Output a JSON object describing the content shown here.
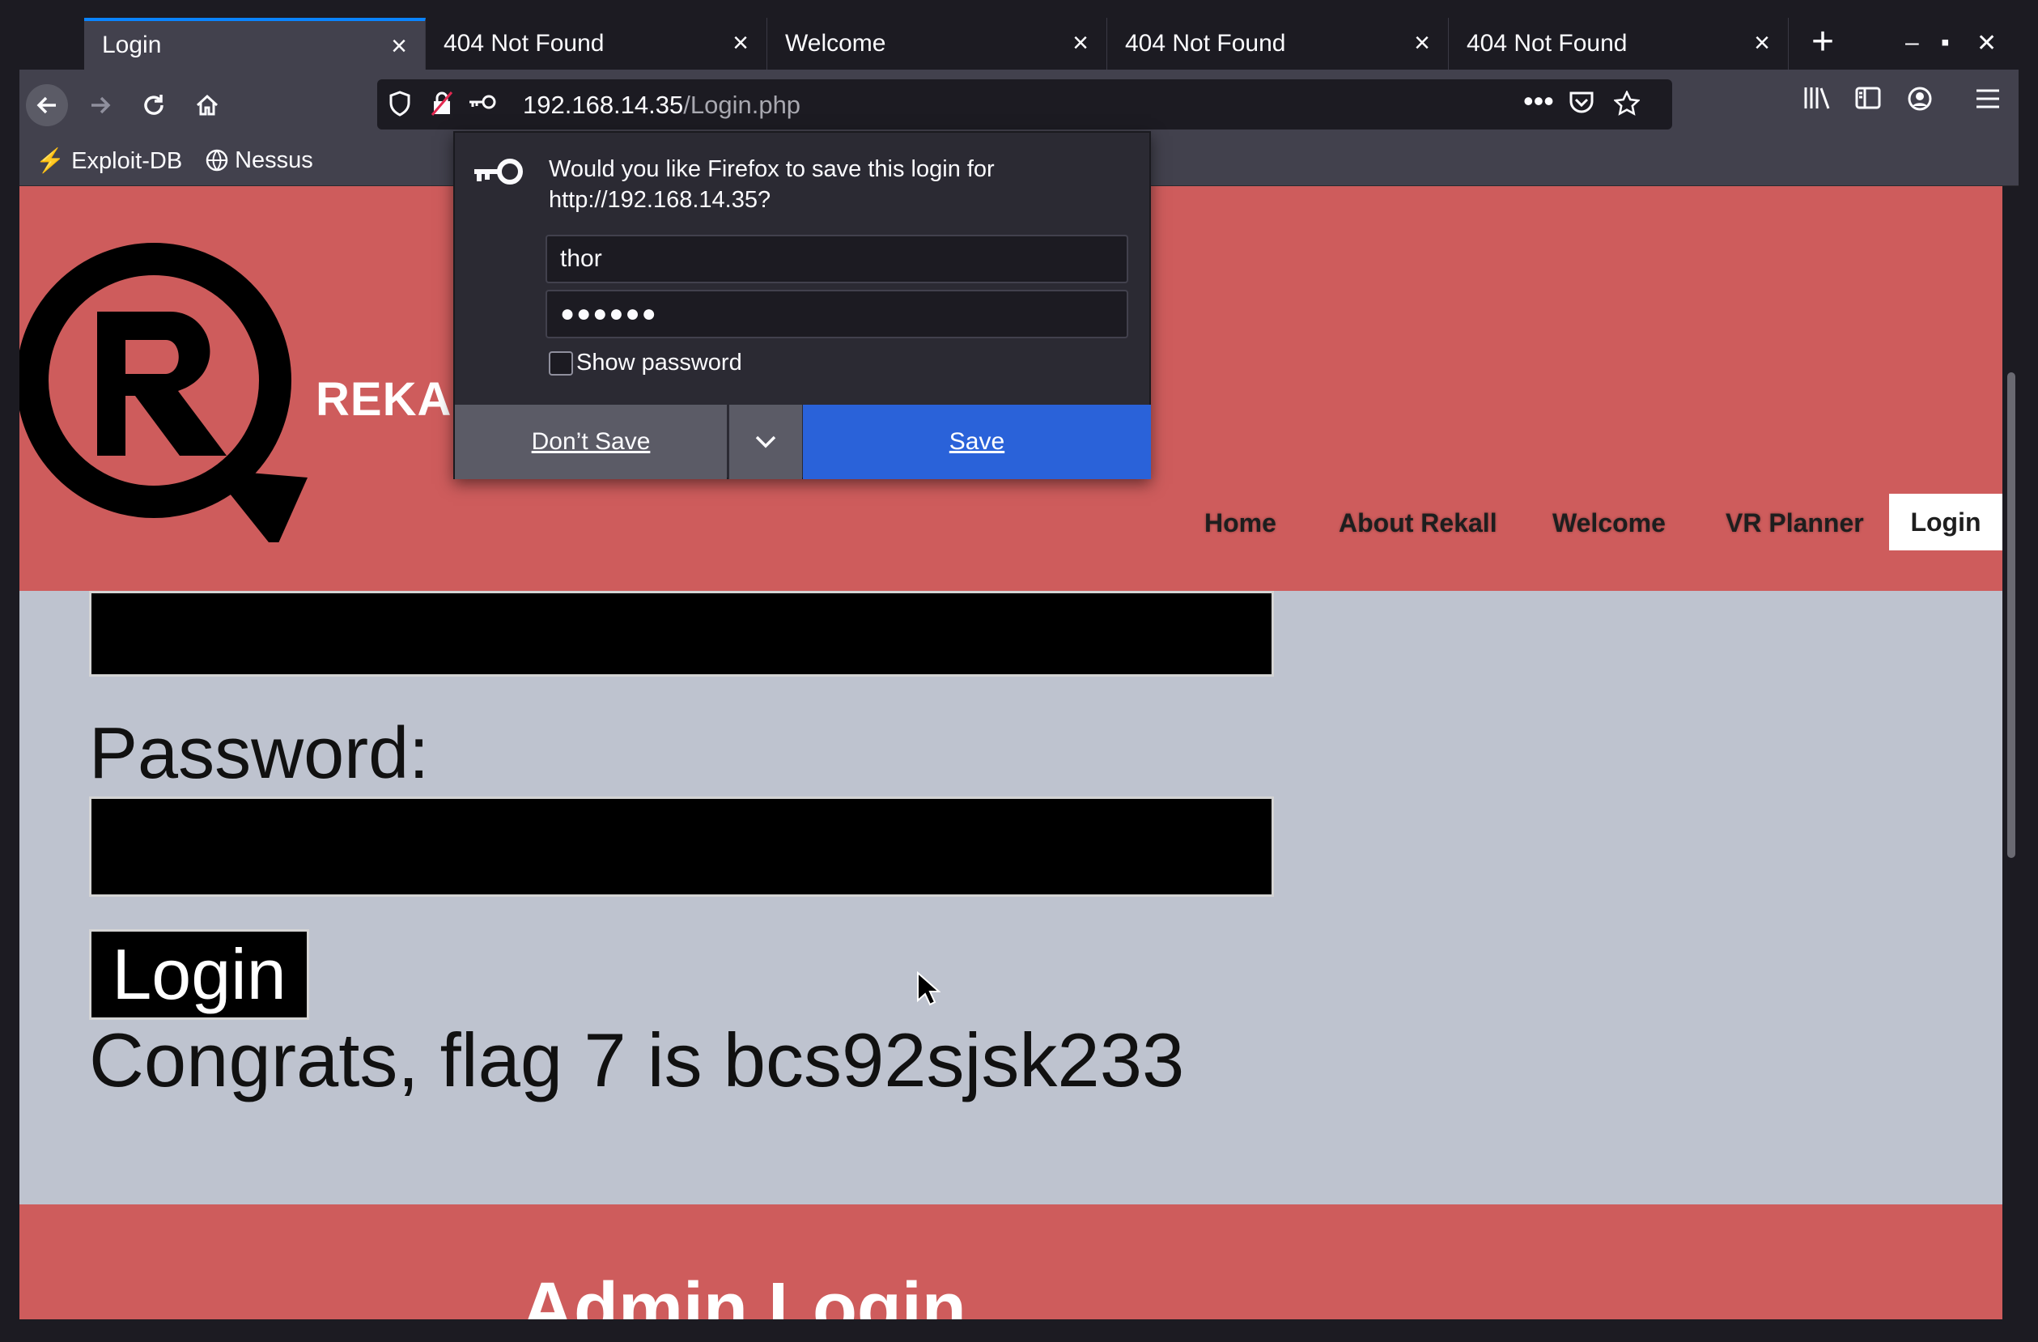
{
  "browser": {
    "tabs": [
      {
        "label": "Login",
        "active": true
      },
      {
        "label": "404 Not Found",
        "active": false
      },
      {
        "label": "Welcome",
        "active": false
      },
      {
        "label": "404 Not Found",
        "active": false
      },
      {
        "label": "404 Not Found",
        "active": false
      }
    ],
    "url_host": "192.168.14.35",
    "url_path": "/Login.php",
    "bookmarks": [
      "Exploit-DB",
      "Nessus"
    ]
  },
  "site": {
    "brand": "REKALL",
    "nav": [
      "Home",
      "About Rekall",
      "Welcome",
      "VR Planner",
      "Login"
    ],
    "password_label": "Password:",
    "login_button": "Login",
    "flag_message": "Congrats, flag 7 is bcs92sjsk233",
    "footer_heading": "Admin Login"
  },
  "save_login_prompt": {
    "message": "Would you like Firefox to save this login for http://192.168.14.35?",
    "username": "thor",
    "password_masked": "●●●●●●",
    "show_password_label": "Show password",
    "dont_save_label": "Don’t Save",
    "save_label": "Save"
  },
  "colors": {
    "header_bg": "#ce5c5c",
    "content_bg": "#bec3cf",
    "save_button": "#2a62d9"
  }
}
